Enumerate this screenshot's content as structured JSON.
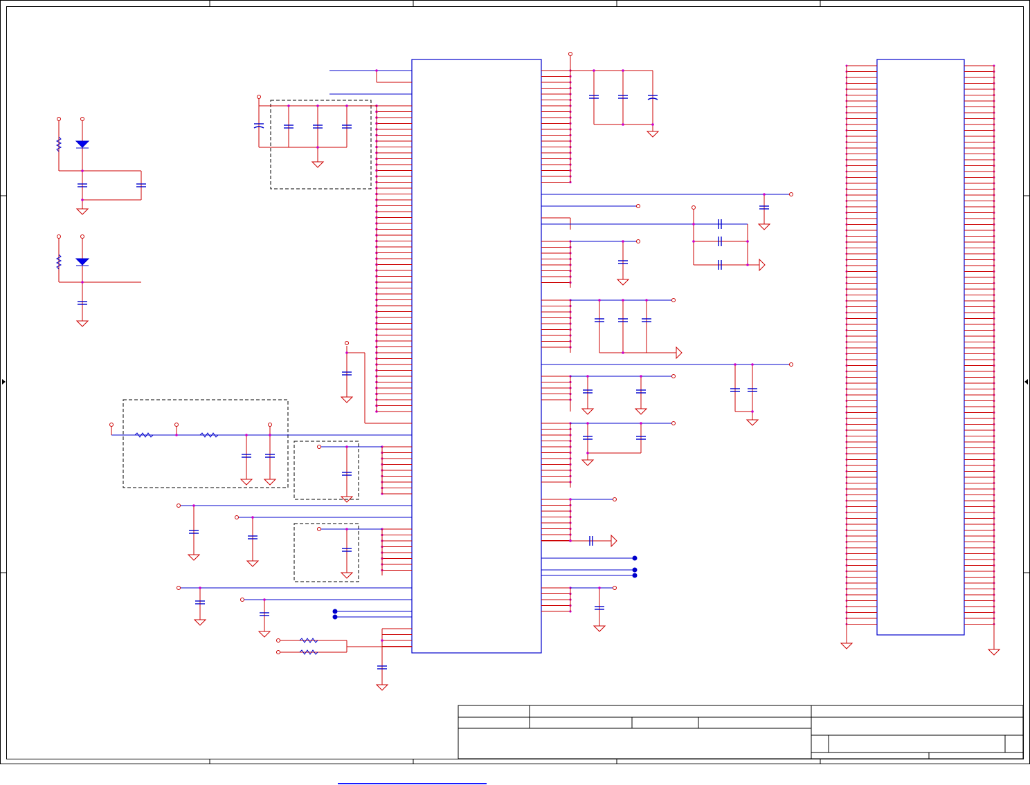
{
  "diagram": {
    "type": "schematic-sheet",
    "colors": {
      "wire": "#cc0000",
      "component": "#0000cc",
      "junction": "#cc00cc",
      "frame": "#000000",
      "test_point": "#0000cc"
    },
    "components": [
      {
        "kind": "ic",
        "name": "main-processor"
      },
      {
        "kind": "connector",
        "name": "board-connector"
      },
      {
        "kind": "capacitor-group",
        "name": "decoupling-caps"
      },
      {
        "kind": "resistor",
        "name": "pullup-resistors"
      },
      {
        "kind": "diode",
        "name": "reference-diodes"
      },
      {
        "kind": "test-point",
        "name": "test-points"
      }
    ],
    "title_block": {
      "title": "",
      "size": "",
      "doc_number": "",
      "rev": "",
      "date": "",
      "sheet": ""
    }
  },
  "footer_link": ""
}
